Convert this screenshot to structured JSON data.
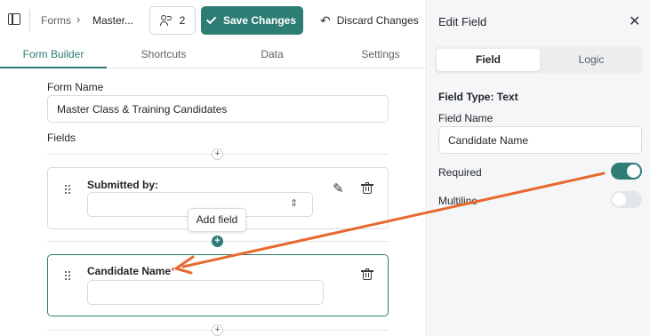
{
  "header": {
    "breadcrumb": [
      "Forms",
      "Master..."
    ],
    "breadcrumb_separator": "›",
    "collaborators_count": "2",
    "save_label": "Save Changes",
    "discard_label": "Discard Changes"
  },
  "tabs": [
    {
      "label": "Form Builder",
      "active": true
    },
    {
      "label": "Shortcuts",
      "active": false
    },
    {
      "label": "Data",
      "active": false
    },
    {
      "label": "Settings",
      "active": false
    }
  ],
  "form": {
    "name_label": "Form Name",
    "name_value": "Master Class & Training Candidates",
    "fields_label": "Fields",
    "add_field_tooltip": "Add field",
    "fields": [
      {
        "label": "Submitted by:",
        "type": "select",
        "value": "",
        "required": false
      },
      {
        "label": "Candidate Name",
        "type": "text",
        "value": "",
        "required": true,
        "required_marker": "*",
        "selected": true
      }
    ]
  },
  "panel": {
    "title": "Edit Field",
    "segments": [
      {
        "label": "Field",
        "active": true
      },
      {
        "label": "Logic",
        "active": false
      }
    ],
    "field_type_label": "Field Type:",
    "field_type_value": "Text",
    "field_name_label": "Field Name",
    "field_name_value": "Candidate Name",
    "required_label": "Required",
    "required_on": true,
    "multiline_label": "Multiline",
    "multiline_on": false
  },
  "colors": {
    "accent": "#2d7d74",
    "annotation_arrow": "#e8692f",
    "required_star": "#d0342c"
  },
  "icons": [
    "sidebar-toggle-icon",
    "users-icon",
    "check-icon",
    "undo-icon",
    "drag-handle-icon",
    "pencil-icon",
    "trash-icon",
    "chevron-updown-icon",
    "plus-icon",
    "close-icon"
  ]
}
